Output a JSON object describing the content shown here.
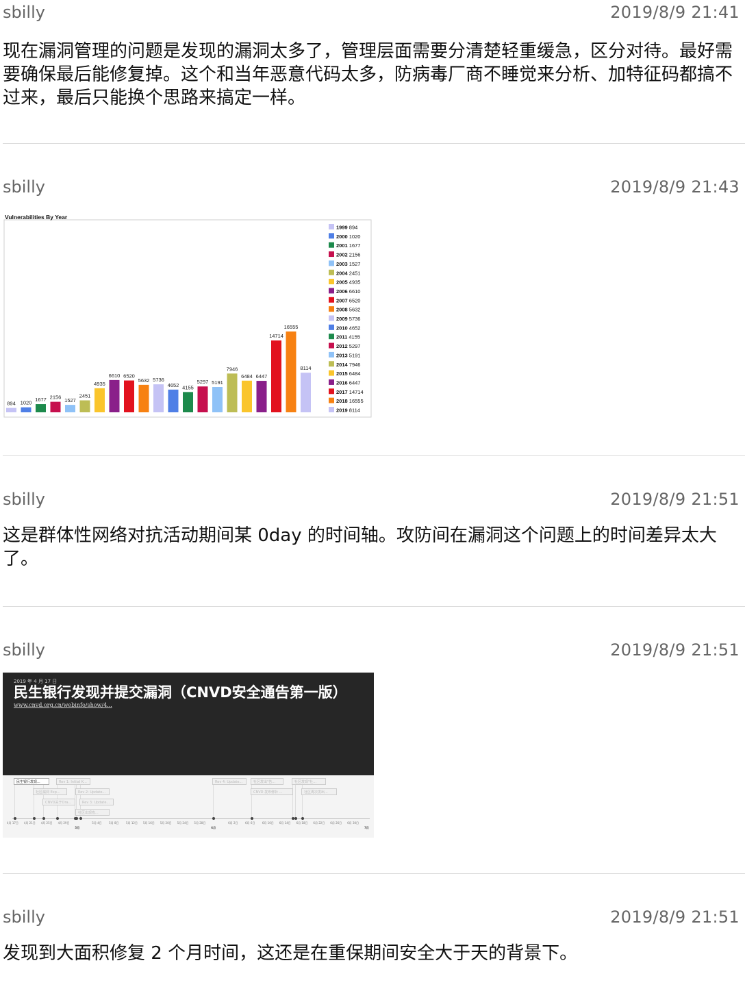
{
  "posts": [
    {
      "author": "sbilly",
      "time": "2019/8/9 21:41",
      "text": "现在漏洞管理的问题是发现的漏洞太多了，管理层面需要分清楚轻重缓急，区分对待。最好需要确保最后能修复掉。这个和当年恶意代码太多，防病毒厂商不睡觉来分析、加特征码都搞不过来，最后只能换个思路来搞定一样。"
    },
    {
      "author": "sbilly",
      "time": "2019/8/9 21:43"
    },
    {
      "author": "sbilly",
      "time": "2019/8/9 21:51",
      "text": "这是群体性网络对抗活动期间某 0day 的时间轴。攻防间在漏洞这个问题上的时间差异太大了。"
    },
    {
      "author": "sbilly",
      "time": "2019/8/9 21:51"
    },
    {
      "author": "sbilly",
      "time": "2019/8/9 21:51",
      "text": "发现到大面积修复 2 个月时间，这还是在重保期间安全大于天的背景下。"
    }
  ],
  "chart_data": {
    "type": "bar",
    "title": "Vulnerabilities By Year",
    "legend": "right",
    "categories": [
      "1999",
      "2000",
      "2001",
      "2002",
      "2003",
      "2004",
      "2005",
      "2006",
      "2007",
      "2008",
      "2009",
      "2010",
      "2011",
      "2012",
      "2013",
      "2014",
      "2015",
      "2016",
      "2017",
      "2018",
      "2019"
    ],
    "values": [
      894,
      1020,
      1677,
      2156,
      1527,
      2451,
      4935,
      6610,
      6520,
      5632,
      5736,
      4652,
      4155,
      5297,
      5191,
      7946,
      6484,
      6447,
      14714,
      16555,
      8114
    ],
    "colors": [
      "#c5c3f5",
      "#4f7fe6",
      "#1d8a4c",
      "#c6104e",
      "#8fc2f7",
      "#bdbd55",
      "#fac52c",
      "#8a1f8a",
      "#e2121e",
      "#f78112",
      "#c5c3f5",
      "#4f7fe6",
      "#1d8a4c",
      "#c6104e",
      "#8fc2f7",
      "#bdbd55",
      "#fac52c",
      "#8a1f8a",
      "#e2121e",
      "#f78112",
      "#c5c3f5"
    ],
    "ylim": [
      0,
      17500
    ]
  },
  "timeline": {
    "date": "2019 年 4 月 17 日",
    "title": "民生银行发现并提交漏洞（CNVD安全通告第一版）",
    "link": "www.cnvd.org.cn/webinfo/show/4...",
    "cards": [
      "民生银行发现...",
      "Rev 1: Initial K...",
      "社区漏洞 Exp...",
      "Rev 2: Update...",
      "CNVD关于Ora...",
      "Rev 3: Update...",
      "社区出现攻...",
      "Rev 4: Update...",
      "社区发出\"告...",
      "社区发现\"社...",
      "CNVD 发布修补 ...",
      "社区再次发出..."
    ],
    "ticks": [
      "4月 17日",
      "4月 21日",
      "4月 25日",
      "4月 29日",
      "5月",
      "5月 4日",
      "5月 8日",
      "5月 12日",
      "5月 16日",
      "5月 20日",
      "5月 24日",
      "5月 28日",
      "6月",
      "6月 2日",
      "6月 6日",
      "6月 10日",
      "6月 14日",
      "6月 18日",
      "6月 22日",
      "6月 26日",
      "6月 30日",
      "7月"
    ]
  }
}
